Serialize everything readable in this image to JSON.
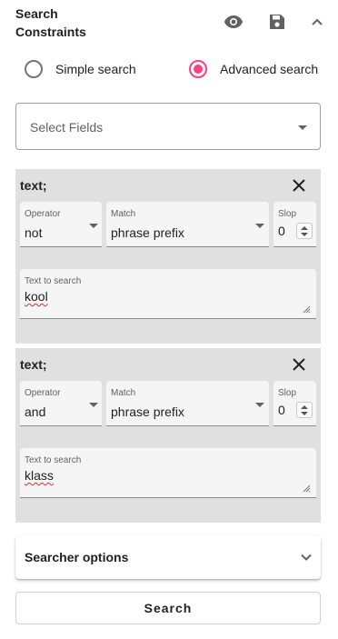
{
  "header": {
    "title": "Search Constraints",
    "icons": [
      "eye-icon",
      "save-icon",
      "chevron-up-icon"
    ]
  },
  "mode": {
    "options": [
      "Simple search",
      "Advanced search"
    ],
    "selected": "Advanced search"
  },
  "select_fields": {
    "placeholder": "Select Fields"
  },
  "constraints": [
    {
      "title": "text;",
      "operator_label": "Operator",
      "operator": "not",
      "match_label": "Match",
      "match": "phrase prefix",
      "slop_label": "Slop",
      "slop": "0",
      "text_label": "Text to search",
      "text": "kool"
    },
    {
      "title": "text;",
      "operator_label": "Operator",
      "operator": "and",
      "match_label": "Match",
      "match": "phrase prefix",
      "slop_label": "Slop",
      "slop": "0",
      "text_label": "Text to search",
      "text": "klass"
    }
  ],
  "searcher_options": {
    "label": "Searcher options"
  },
  "search_button": {
    "label": "Search"
  },
  "colors": {
    "accent": "#ff4081",
    "panel": "#e0e0e0"
  }
}
